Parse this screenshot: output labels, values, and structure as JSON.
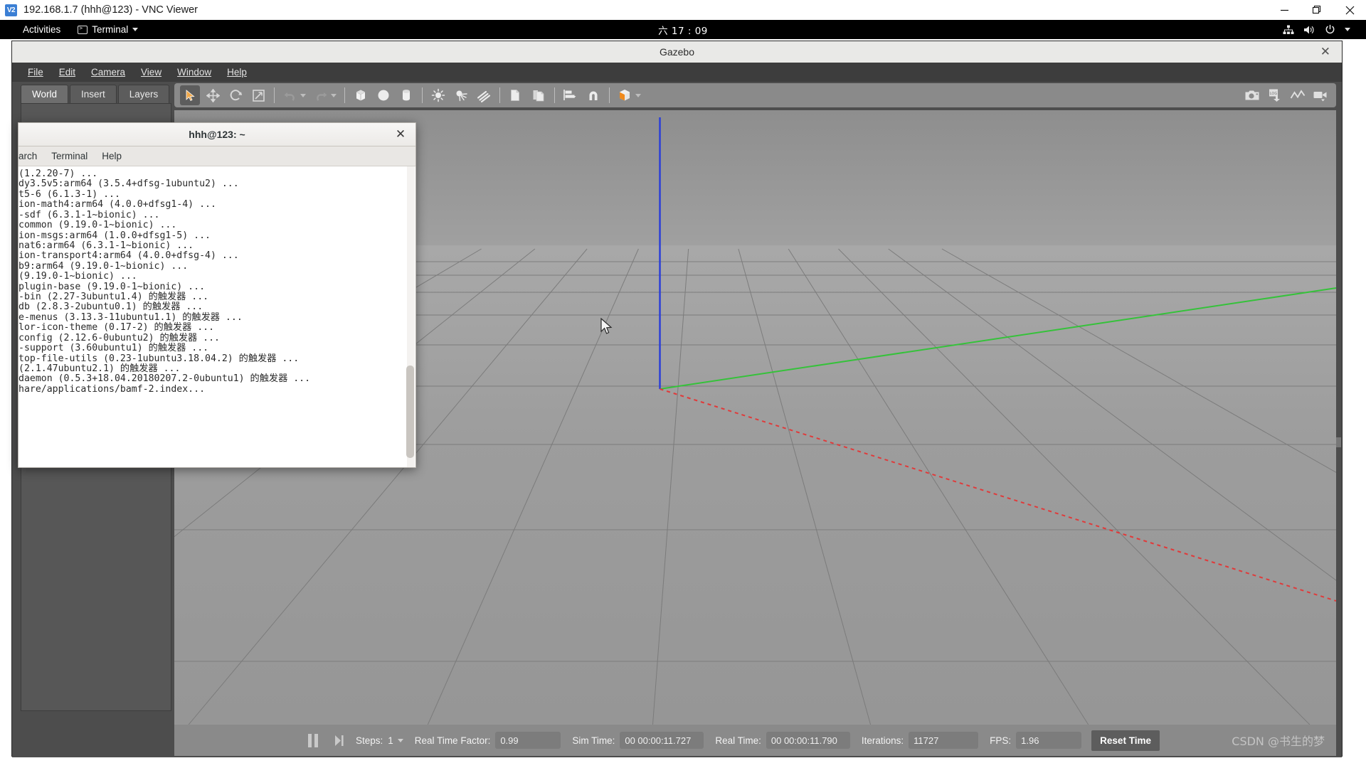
{
  "vnc": {
    "logo_text": "V2",
    "title": "192.168.1.7 (hhh@123) - VNC Viewer",
    "minimize_label": "—",
    "maximize_label": "❐",
    "close_label": "✕"
  },
  "gnome": {
    "activities": "Activities",
    "app_indicator": "Terminal",
    "clock": "六 17 : 09",
    "status_icons": [
      "network-icon",
      "volume-icon",
      "power-icon",
      "chevron-down-icon"
    ]
  },
  "gazebo": {
    "title": "Gazebo",
    "close_label": "✕",
    "menus": [
      "File",
      "Edit",
      "Camera",
      "View",
      "Window",
      "Help"
    ],
    "tabs": [
      {
        "label": "World",
        "active": true
      },
      {
        "label": "Insert",
        "active": false
      },
      {
        "label": "Layers",
        "active": false
      }
    ],
    "toolbar_left": [
      "select-arrow-icon",
      "translate-icon",
      "rotate-icon",
      "scale-icon",
      "sep",
      "undo-icon",
      "undo-dropdown-caret",
      "redo-icon",
      "redo-dropdown-caret",
      "sep",
      "box-icon",
      "sphere-icon",
      "cylinder-icon",
      "sep",
      "point-light-icon",
      "spot-light-icon",
      "directional-light-icon",
      "sep",
      "copy-icon",
      "paste-icon",
      "sep",
      "align-icon",
      "snap-icon",
      "sep",
      "view-angle-cube-icon"
    ],
    "toolbar_right": [
      "screenshot-camera-icon",
      "log-download-icon",
      "plot-icon",
      "video-record-icon"
    ],
    "accent_orange": "#ef8a1e",
    "status": {
      "pause_icon": "pause-icon",
      "step_forward_icon": "step-forward-icon",
      "steps_label": "Steps:",
      "steps_value": "1",
      "rtf_label": "Real Time Factor:",
      "rtf_value": "0.99",
      "sim_time_label": "Sim Time:",
      "sim_time_value": "00 00:00:11.727",
      "real_time_label": "Real Time:",
      "real_time_value": "00 00:00:11.790",
      "iterations_label": "Iterations:",
      "iterations_value": "11727",
      "fps_label": "FPS:",
      "fps_value": "1.96",
      "reset_time_label": "Reset Time"
    },
    "watermark": "CSDN @书生的梦"
  },
  "terminal": {
    "title": "hhh@123: ~",
    "close_label": "✕",
    "menus": [
      "arch",
      "Terminal",
      "Help"
    ],
    "lines": [
      "(1.2.20-7) ...",
      "dy3.5v5:arm64 (3.5.4+dfsg-1ubuntu2) ...",
      "t5-6 (6.1.3-1) ...",
      "ion-math4:arm64 (4.0.0+dfsg1-4) ...",
      "-sdf (6.3.1-1~bionic) ...",
      "common (9.19.0-1~bionic) ...",
      "ion-msgs:arm64 (1.0.0+dfsg1-5) ...",
      "nat6:arm64 (6.3.1-1~bionic) ...",
      "ion-transport4:arm64 (4.0.0+dfsg-4) ...",
      "b9:arm64 (9.19.0-1~bionic) ...",
      "(9.19.0-1~bionic) ...",
      "plugin-base (9.19.0-1~bionic) ...",
      "-bin (2.27-3ubuntu1.4) 的触发器 ...",
      "db (2.8.3-2ubuntu0.1) 的触发器 ...",
      "e-menus (3.13.3-11ubuntu1.1) 的触发器 ...",
      "lor-icon-theme (0.17-2) 的触发器 ...",
      "config (2.12.6-0ubuntu2) 的触发器 ...",
      "-support (3.60ubuntu1) 的触发器 ...",
      "top-file-utils (0.23-1ubuntu3.18.04.2) 的触发器 ...",
      "(2.1.47ubuntu2.1) 的触发器 ...",
      "daemon (0.5.3+18.04.20180207.2-0ubuntu1) 的触发器 ...",
      "hare/applications/bamf-2.index..."
    ]
  }
}
